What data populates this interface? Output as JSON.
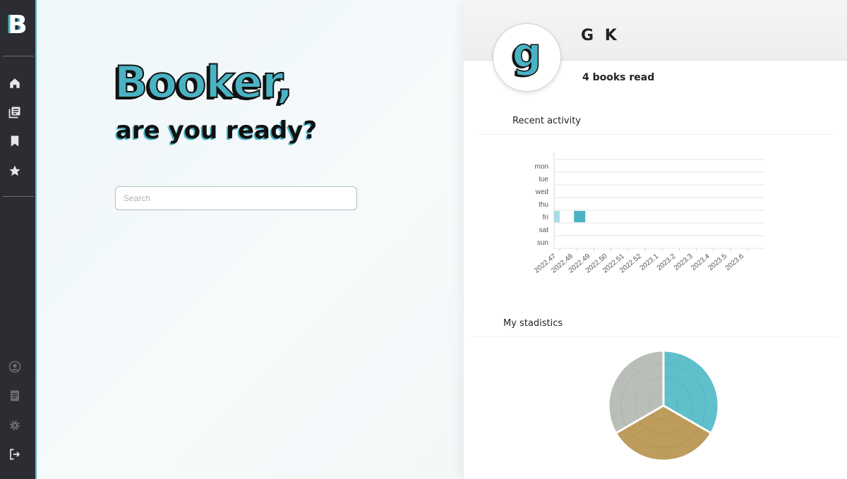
{
  "app": {
    "logo_letter": "B"
  },
  "sidebar": {
    "top_items": [
      {
        "icon": "home-icon"
      },
      {
        "icon": "library-icon"
      },
      {
        "icon": "bookmark-icon"
      },
      {
        "icon": "star-icon"
      }
    ],
    "bottom_items": [
      {
        "icon": "user-icon"
      },
      {
        "icon": "notes-icon"
      },
      {
        "icon": "gear-icon"
      },
      {
        "icon": "logout-icon"
      }
    ]
  },
  "hero": {
    "title": "Booker,",
    "subtitle": "are you ready?"
  },
  "search": {
    "placeholder": "Search",
    "value": ""
  },
  "profile": {
    "avatar_letter": "g",
    "name": "G K",
    "books_read": "4 books read"
  },
  "sections": {
    "activity_title": "Recent activity",
    "stats_title": "My stadistics"
  },
  "colors": {
    "accent": "#4ab3c3",
    "sidebar": "#2b2d33",
    "pie_teal": "#5fbfcb",
    "pie_gold": "#bd9c5c",
    "pie_grey": "#b9bfb8"
  },
  "chart_data": [
    {
      "type": "heatmap",
      "title": "Recent activity",
      "x": [
        "2022.47",
        "2022.48",
        "2022.49",
        "2022.50",
        "2022.51",
        "2022.52",
        "2023.1",
        "2023.2",
        "2023.3",
        "2023.4",
        "2023.5",
        "2023.6"
      ],
      "y": [
        "mon",
        "tue",
        "wed",
        "thu",
        "fri",
        "sat",
        "sun"
      ],
      "cells": [
        {
          "x": "2022.47",
          "y": "fri",
          "value": 1
        },
        {
          "x": "2022.48",
          "y": "fri",
          "value": 3
        }
      ]
    },
    {
      "type": "pie",
      "title": "My stadistics",
      "values": [
        1,
        1,
        1
      ],
      "colors": [
        "#5fbfcb",
        "#bd9c5c",
        "#b9bfb8"
      ]
    }
  ]
}
